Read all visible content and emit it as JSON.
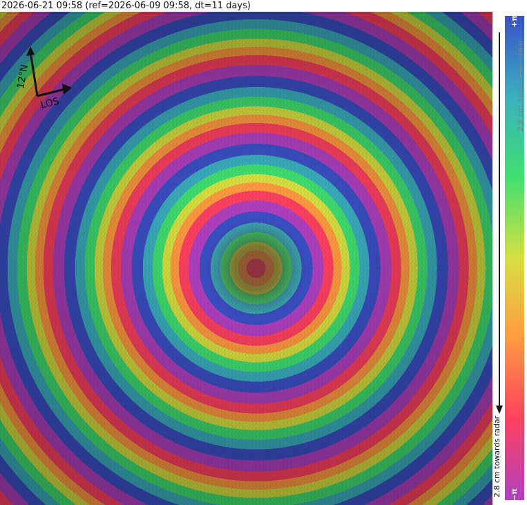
{
  "title": "2026-06-21 09:58 (ref=2026-06-09 09:58, dt=11 days)",
  "compass": {
    "north_label": "12°N",
    "los_label": "LOS"
  },
  "colorbar": {
    "top_label": "+π",
    "bottom_label": "−π",
    "away_label": "2.8 cm away from radar",
    "towards_label": "2.8 cm towards radar",
    "colors": [
      "#ff4060",
      "#ff9a40",
      "#d7e040",
      "#40e070",
      "#3ab0c0",
      "#3b50c8",
      "#b040c0"
    ]
  }
}
